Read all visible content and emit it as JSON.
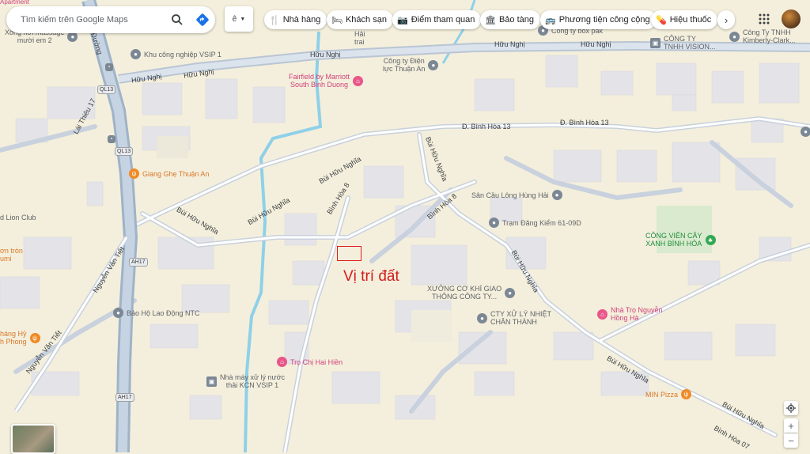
{
  "search": {
    "placeholder": "Tìm kiếm trên Google Maps"
  },
  "layers": {
    "label": "ê"
  },
  "categories": [
    {
      "icon": "restaurant-icon",
      "glyph": "🍴",
      "label": "Nhà hàng"
    },
    {
      "icon": "hotel-icon",
      "glyph": "🛏",
      "label": "Khách sạn"
    },
    {
      "icon": "camera-icon",
      "glyph": "📷",
      "label": "Điểm tham quan"
    },
    {
      "icon": "museum-icon",
      "glyph": "🏛",
      "label": "Bảo tàng"
    },
    {
      "icon": "bus-icon",
      "glyph": "🚌",
      "label": "Phương tiện công cộng"
    },
    {
      "icon": "pharmacy-icon",
      "glyph": "💊",
      "label": "Hiệu thuốc"
    }
  ],
  "annotation": {
    "text": "Vị trí đất",
    "color": "#d21d1d"
  },
  "roads": {
    "huu_nghi_1": "Hữu Nghị",
    "huu_nghi_2": "Hữu Nghị",
    "huu_nghi_3": "Hữu Nghị",
    "huu_nghi_4": "Hữu Nghị",
    "huu_nghi_5": "Hữu Nghị",
    "lai_thieu": "Lái Thiêu 17",
    "binh_hoa_13a": "Đ. Bình Hòa 13",
    "binh_hoa_13b": "Đ. Bình Hòa 13",
    "bui_huu_nghia_1": "Bùi Hữu Nghĩa",
    "bui_huu_nghia_2": "Bùi Hữu Nghĩa",
    "bui_huu_nghia_3": "Bùi Hữu Nghĩa",
    "bui_huu_nghia_4": "Bùi Hữu Nghĩa",
    "bui_huu_nghia_5": "Bùi Hữu Nghĩa",
    "bui_huu_nghia_6": "Bùi Hữu Nghĩa",
    "bui_huu_nghia_7": "Bùi Hữu Nghĩa",
    "binh_hoa_8a": "Bình Hòa 8",
    "binh_hoa_8b": "Bình Hòa 8",
    "nguyen_van_tiet_1": "Nguyễn Văn Tiết",
    "nguyen_van_tiet_2": "Nguyễn Văn Tiết",
    "binh_hoa_07": "Bình Hòa 07",
    "duong": "Đường",
    "ql13a": "QL13",
    "ql13b": "QL13",
    "ah17a": "AH17",
    "ah17b": "AH17"
  },
  "pois": {
    "khu_cn_vsip": "Khu công nghiệp VSIP 1",
    "cty_dien_luc": "Công ty Điện\nlực Thuận An",
    "fairfield": "Fairfield by Marriott\nSouth Binh Duong",
    "cty_box": "Công ty box pak",
    "cty_vision": "CÔNG TY\nTNHH VISION...",
    "cty_kimberly": "Công Ty TNHH\nKimberly-Clark...",
    "xong_hoi": "Xông hơi massage\nmười em 2",
    "giang_ghe": "Giang Ghẹ Thuận An",
    "lion_club": "d Lion Club",
    "don_tron": "ơn tròn\numi",
    "hang_hy": "háng Hỷ\nh Phong",
    "san_cau_long": "Sân Cầu Lông Hùng Hải",
    "tram_dang_kiem": "Trạm Đăng Kiểm 61-09D",
    "cong_vien": "CÔNG VIÊN CÂY\nXANH BÌNH HÒA",
    "xuong_co_khi": "XƯỞNG CƠ KHÍ GIAO\nTHÔNG CÔNG TY...",
    "cty_xu_ly": "CTY XỬ LÝ NHIỆT\nCHÂN THÀNH",
    "nha_tro_nguyen": "Nhà Trọ Nguyễn\nHồng Hà",
    "bao_ho": "Bảo Hộ Lao Động NTC",
    "tro_chi": "Trọ Chị Hai Hiền",
    "nha_may": "Nhà máy xử lý nước\nthải KCN VSIP 1",
    "min_pizza": "MIN Pizza",
    "hai_trai": "Hải\ntrai",
    "apartment": "Apartment"
  },
  "controls": {
    "zoom_in": "+",
    "zoom_out": "−"
  }
}
